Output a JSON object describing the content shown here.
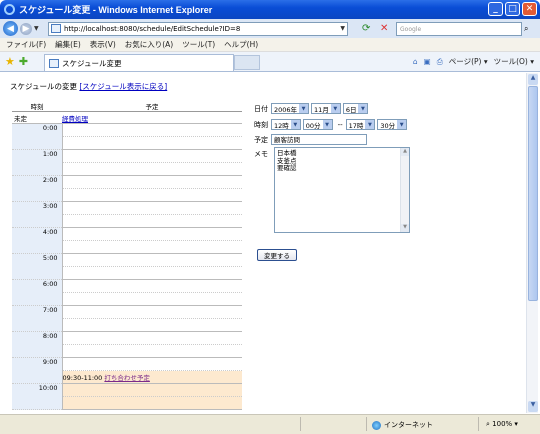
{
  "window": {
    "title": "スケジュール変更 - Windows Internet Explorer"
  },
  "address": {
    "url": "http://localhost:8080/schedule/EditSchedule?ID=8",
    "search_placeholder": "Google"
  },
  "menu": [
    "ファイル(F)",
    "編集(E)",
    "表示(V)",
    "お気に入り(A)",
    "ツール(T)",
    "ヘルプ(H)"
  ],
  "tab": {
    "label": "スケジュール変更"
  },
  "tools": [
    "ページ(P) ▾",
    "ツール(O) ▾"
  ],
  "page": {
    "heading": "スケジュールの変更",
    "back_link": "[スケジュール表示に戻る]",
    "table": {
      "col_time": "時刻",
      "col_plan": "予定",
      "unset_label": "未定",
      "unset_event": "経費処理",
      "hours": [
        "0:00",
        "1:00",
        "2:00",
        "3:00",
        "4:00",
        "5:00",
        "6:00",
        "7:00",
        "8:00",
        "9:00",
        "10:00"
      ],
      "event": {
        "time": "09:30-11:00",
        "label": "打ち合わせ予定"
      }
    },
    "form": {
      "date_label": "日付",
      "year": "2006年",
      "month": "11月",
      "day": "6日",
      "time_label": "時刻",
      "start_hour": "12時",
      "start_min": "00分",
      "separator": "--",
      "end_hour": "17時",
      "end_min": "30分",
      "plan_label": "予定",
      "plan_value": "顧客訪問",
      "memo_label": "メモ",
      "memo_lines": [
        "日本橋",
        "支釜点",
        "要確認"
      ],
      "submit_label": "変更する"
    }
  },
  "status": {
    "zone": "インターネット",
    "zoom": "100%"
  }
}
